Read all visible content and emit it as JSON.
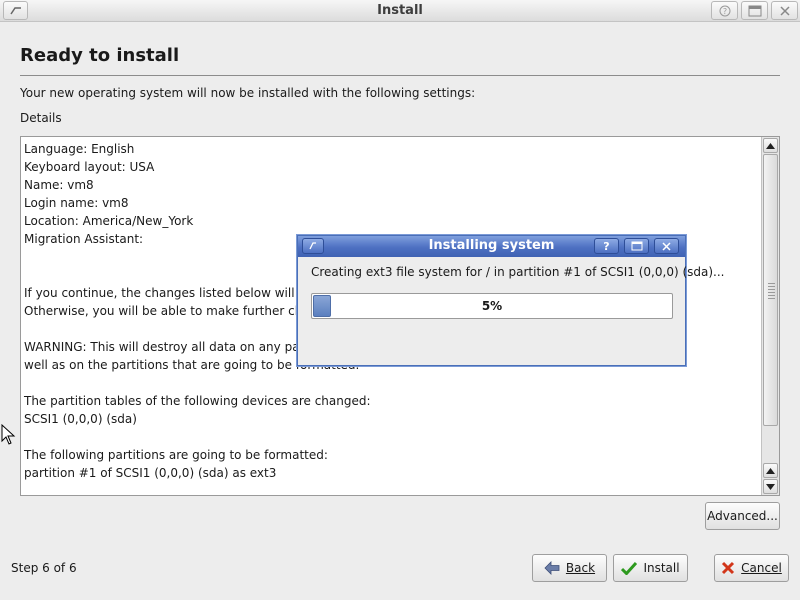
{
  "window": {
    "title": "Install"
  },
  "page": {
    "heading": "Ready to install",
    "subtitle": "Your new operating system will now be installed with the following settings:",
    "details_label": "Details",
    "details_lines": [
      "Language: English",
      "Keyboard layout: USA",
      "Name: vm8",
      "Login name: vm8",
      "Location: America/New_York",
      "Migration Assistant:",
      "",
      "",
      "If you continue, the changes listed below will be wr",
      "Otherwise, you will be able to make further change",
      "",
      "WARNING: This will destroy all data on any partitio",
      "well as on the partitions that are going to be formatted.",
      "",
      "The partition tables of the following devices are changed:",
      "SCSI1 (0,0,0) (sda)",
      "",
      "The following partitions are going to be formatted:",
      "partition #1 of SCSI1 (0,0,0) (sda) as ext3"
    ]
  },
  "buttons": {
    "advanced": "Advanced...",
    "back": "Back",
    "install": "Install",
    "cancel": "Cancel"
  },
  "footer": {
    "step": "Step 6 of 6"
  },
  "dialog": {
    "title": "Installing system",
    "help_glyph": "?",
    "message": "Creating ext3 file system for / in partition #1 of SCSI1 (0,0,0) (sda)...",
    "progress_text": "5%",
    "progress_fraction": 0.05
  },
  "colors": {
    "dialog_titlebar": "#4d70c2",
    "progress_fill": "#5b7fbf",
    "background": "#ededed"
  }
}
